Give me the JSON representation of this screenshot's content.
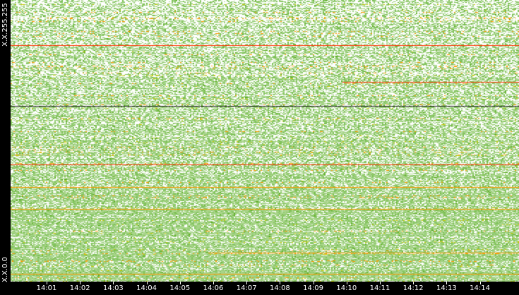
{
  "chart_data": {
    "type": "heatmap",
    "title": "",
    "xlabel": "",
    "ylabel": "",
    "x_tick_labels": [
      "14:01",
      "14:02",
      "14:03",
      "14:04",
      "14:05",
      "14:06",
      "14:07",
      "14:08",
      "14:09",
      "14:10",
      "14:11",
      "14:12",
      "14:13",
      "14:14"
    ],
    "y_tick_labels": {
      "top": "X.X.255.255",
      "bottom": "X.X.0.0"
    },
    "color_scale": [
      "#ffffff",
      "#a8d48a",
      "#7fc25a",
      "#5aaa1e",
      "#c8c800",
      "#ff9900",
      "#ff3300"
    ],
    "colors": {
      "background": "#000000",
      "low": "#ffffff",
      "mid": "#7fc25a",
      "high": "#ff3300"
    }
  }
}
